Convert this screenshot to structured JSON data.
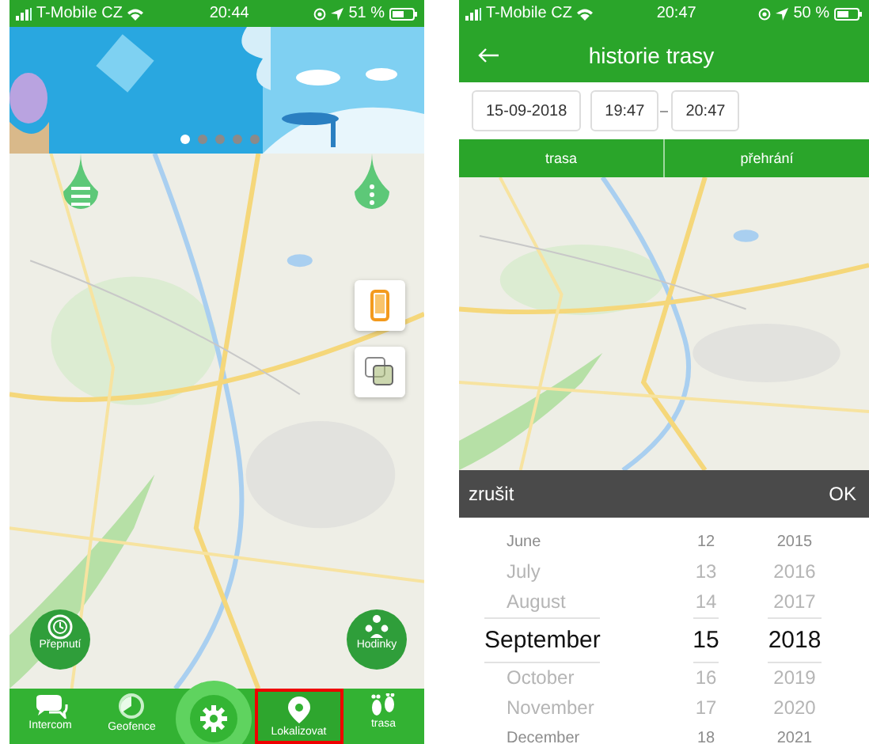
{
  "map_screen": {
    "status_bar": {
      "carrier": "T-Mobile CZ",
      "time": "20:44",
      "battery": "51 %"
    },
    "banner": {
      "kind": "picture",
      "dots": [
        {
          "selected": true
        },
        {
          "selected": false
        },
        {
          "selected": false
        },
        {
          "selected": false
        },
        {
          "selected": false
        }
      ]
    },
    "map": {
      "kind": "picture"
    },
    "round_buttons": [
      {
        "kind": "switch",
        "label": "Přepnutí"
      },
      {
        "kind": "people",
        "label": "Hodinky"
      }
    ],
    "nav": [
      {
        "kind": "chat",
        "label": "Intercom",
        "selected": false
      },
      {
        "kind": "radar",
        "label": "Geofence",
        "selected": false
      },
      {
        "kind": "settings",
        "selected": false
      },
      {
        "kind": "pin",
        "label": "Lokalizovat",
        "selected": true
      },
      {
        "kind": "feet",
        "label": "trasa",
        "selected": false
      }
    ]
  },
  "history_screen": {
    "status_bar": {
      "carrier": "T-Mobile CZ",
      "time": "20:47",
      "battery": "50 %"
    },
    "title": "historie trasy",
    "date": "15-09-2018",
    "time_from": "19:47",
    "time_to": "20:47",
    "tabs": [
      "trasa",
      "přehrání"
    ],
    "map": {
      "kind": "picture"
    },
    "picker": {
      "cancel": "zrušit",
      "ok": "OK",
      "columns": [
        {
          "items": [
            {
              "text": "June",
              "selected": false
            },
            {
              "text": "July",
              "selected": false
            },
            {
              "text": "August",
              "selected": false
            },
            {
              "text": "September",
              "selected": true
            },
            {
              "text": "October",
              "selected": false
            },
            {
              "text": "November",
              "selected": false
            },
            {
              "text": "December",
              "selected": false
            }
          ]
        },
        {
          "items": [
            {
              "text": "12",
              "selected": false
            },
            {
              "text": "13",
              "selected": false
            },
            {
              "text": "14",
              "selected": false
            },
            {
              "text": "15",
              "selected": true
            },
            {
              "text": "16",
              "selected": false
            },
            {
              "text": "17",
              "selected": false
            },
            {
              "text": "18",
              "selected": false
            }
          ]
        },
        {
          "items": [
            {
              "text": "2015",
              "selected": false
            },
            {
              "text": "2016",
              "selected": false
            },
            {
              "text": "2017",
              "selected": false
            },
            {
              "text": "2018",
              "selected": true
            },
            {
              "text": "2019",
              "selected": false
            },
            {
              "text": "2020",
              "selected": false
            },
            {
              "text": "2021",
              "selected": false
            }
          ]
        }
      ]
    }
  }
}
